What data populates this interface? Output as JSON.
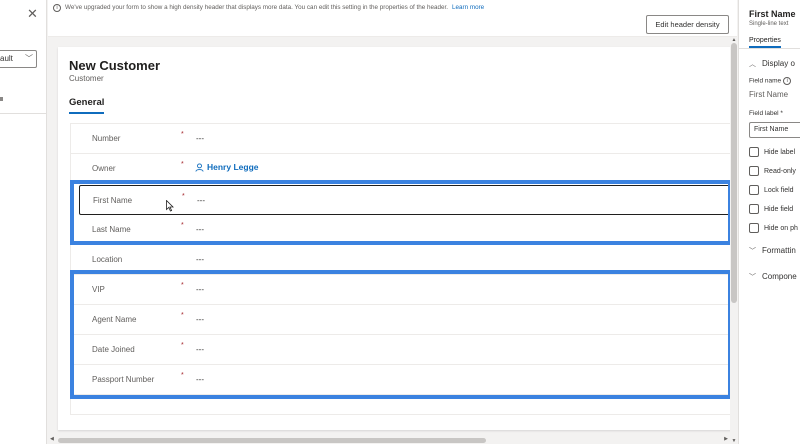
{
  "left_panel": {
    "close_icon": "close-icon",
    "select_value": "ault"
  },
  "notification": {
    "text": "We've upgraded your form to show a high density header that displays more data. You can edit this setting in the properties of the header.",
    "link": "Learn more",
    "button": "Edit header density"
  },
  "form": {
    "title": "New Customer",
    "subtitle": "Customer",
    "tab": "General",
    "empty_value": "---",
    "fields": [
      {
        "label": "Number",
        "required": "*",
        "value": "---"
      },
      {
        "label": "Owner",
        "required": "*",
        "value": "Henry Legge"
      },
      {
        "label": "First Name",
        "required": "*",
        "value": "---"
      },
      {
        "label": "Last Name",
        "required": "*",
        "value": "---"
      },
      {
        "label": "Location",
        "required": "",
        "value": "---"
      },
      {
        "label": "VIP",
        "required": "*",
        "value": "---"
      },
      {
        "label": "Agent Name",
        "required": "*",
        "value": "---"
      },
      {
        "label": "Date Joined",
        "required": "*",
        "value": "---"
      },
      {
        "label": "Passport Number",
        "required": "*",
        "value": "---"
      }
    ]
  },
  "properties": {
    "title": "First Name",
    "subtitle": "Single-line text",
    "tab": "Properties",
    "display_section": "Display o",
    "field_name_label": "Field name",
    "field_name_value": "First Name",
    "field_label_label": "Field label *",
    "field_label_value": "First Name",
    "checks": [
      "Hide label",
      "Read-only",
      "Lock field",
      "Hide field",
      "Hide on ph"
    ],
    "formatting_section": "Formattin",
    "components_section": "Compone"
  },
  "colors": {
    "highlight": "#3b82e0",
    "accent": "#0f6cbd",
    "required": "#a4262c"
  }
}
